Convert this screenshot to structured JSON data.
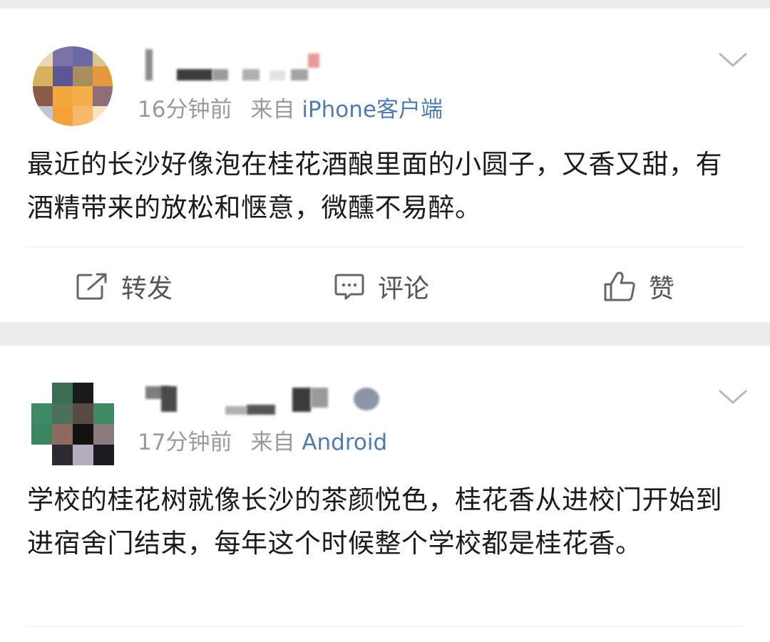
{
  "posts": [
    {
      "time": "16分钟前",
      "source_prefix": "来自",
      "source": "iPhone客户端",
      "text": "最近的长沙好像泡在桂花酒酿里面的小圆子，又香又甜，有酒精带来的放松和惬意，微醺不易醉。",
      "actions": {
        "repost": "转发",
        "comment": "评论",
        "like": "赞"
      }
    },
    {
      "time": "17分钟前",
      "source_prefix": "来自",
      "source": "Android",
      "text": "学校的桂花树就像长沙的茶颜悦色，桂花香从进校门开始到进宿舍门结束，每年这个时候整个学校都是桂花香。"
    }
  ],
  "icons": {
    "chevron": "chevron-down-icon",
    "repost": "repost-icon",
    "comment": "comment-icon",
    "like": "thumbs-up-icon"
  },
  "colors": {
    "background": "#ececec",
    "card": "#ffffff",
    "link": "#4f7bb0",
    "meta": "#9a9a9a",
    "text": "#1b1b1b"
  }
}
